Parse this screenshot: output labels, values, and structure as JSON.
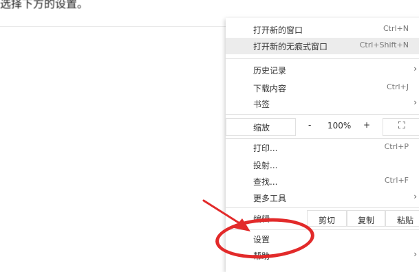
{
  "instruction": "选择下方的设置。",
  "menu": {
    "new_window": {
      "label": "打开新的窗口",
      "shortcut": "Ctrl+N"
    },
    "new_incognito": {
      "label": "打开新的无痕式窗口",
      "shortcut": "Ctrl+Shift+N"
    },
    "history": {
      "label": "历史记录"
    },
    "downloads": {
      "label": "下载内容",
      "shortcut": "Ctrl+J"
    },
    "bookmarks": {
      "label": "书签"
    },
    "zoom": {
      "label": "缩放",
      "minus": "-",
      "value": "100%",
      "plus": "+",
      "fullscreen": "⛶"
    },
    "print": {
      "label": "打印...",
      "shortcut": "Ctrl+P"
    },
    "cast": {
      "label": "投射..."
    },
    "find": {
      "label": "查找...",
      "shortcut": "Ctrl+F"
    },
    "more_tools": {
      "label": "更多工具"
    },
    "edit": {
      "label": "编辑",
      "cut": "剪切",
      "copy": "复制",
      "paste": "粘贴"
    },
    "settings": {
      "label": "设置"
    },
    "help": {
      "label": "帮助"
    },
    "submenu_arrow": "›"
  },
  "annotation_color": "#e22a2a"
}
